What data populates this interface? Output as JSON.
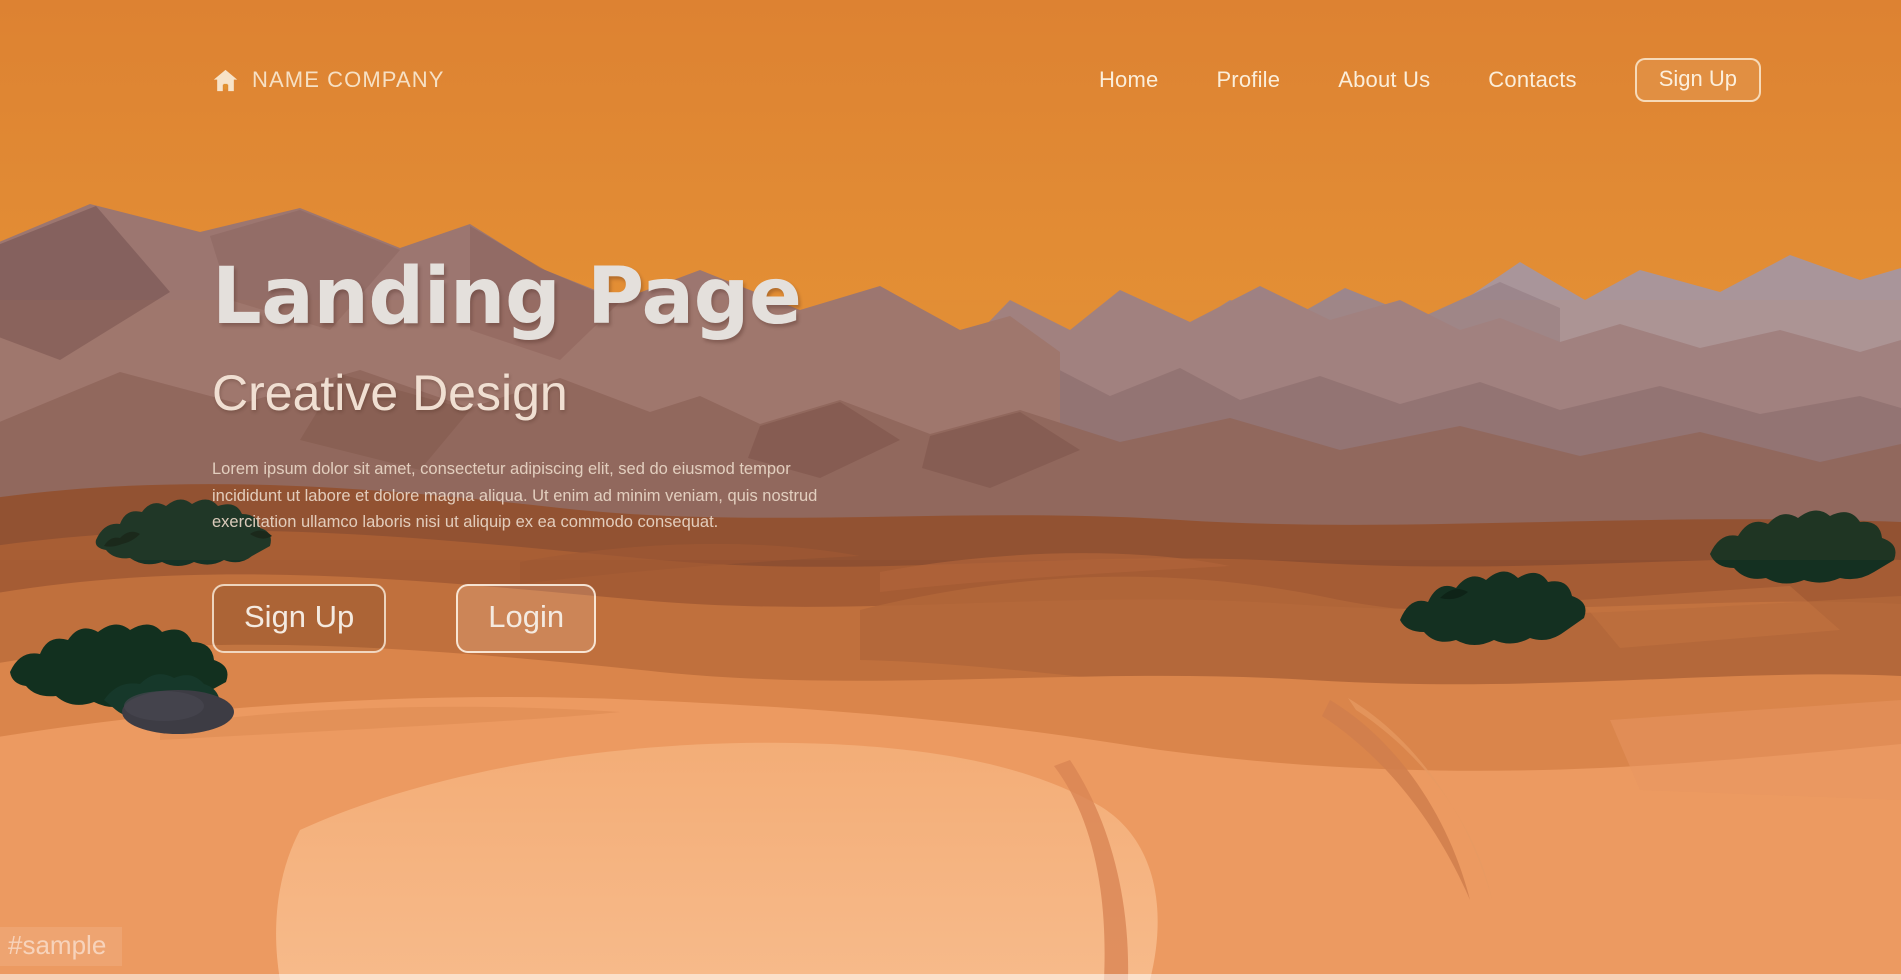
{
  "brand": {
    "icon": "home-icon",
    "name": "NAME COMPANY"
  },
  "nav": {
    "links": [
      {
        "label": "Home"
      },
      {
        "label": "Profile"
      },
      {
        "label": "About Us"
      },
      {
        "label": "Contacts"
      }
    ],
    "cta_label": "Sign Up"
  },
  "hero": {
    "title": "Landing Page",
    "subtitle": "Creative Design",
    "body": "Lorem ipsum dolor sit amet, consectetur adipiscing elit, sed do eiusmod tempor incididunt ut labore et dolore magna aliqua. Ut enim ad minim veniam, quis nostrud exercitation ullamco laboris nisi ut aliquip ex ea commodo consequat.",
    "primary_label": "Sign Up",
    "secondary_label": "Login"
  },
  "watermark": {
    "text": "#sample"
  },
  "colors": {
    "sky_top": "#DE8433",
    "sky_bottom": "#EFA832",
    "mountain_far": "#A08A90",
    "mountain_mid": "#9C7F80",
    "mountain_near": "#8A6A63",
    "rock_dark": "#6E4F48",
    "dune_shadow": "#8E4F31",
    "dune_deep": "#A35B34",
    "dune_mid": "#C8703C",
    "dune_light": "#E08B4F",
    "dune_pale": "#F0A571",
    "dune_palest": "#F6B585",
    "bush_green": "#143024",
    "rock_gray": "#3C3B42",
    "text_cream": "#F6E0C4",
    "heading_light": "#E4E0DC"
  }
}
